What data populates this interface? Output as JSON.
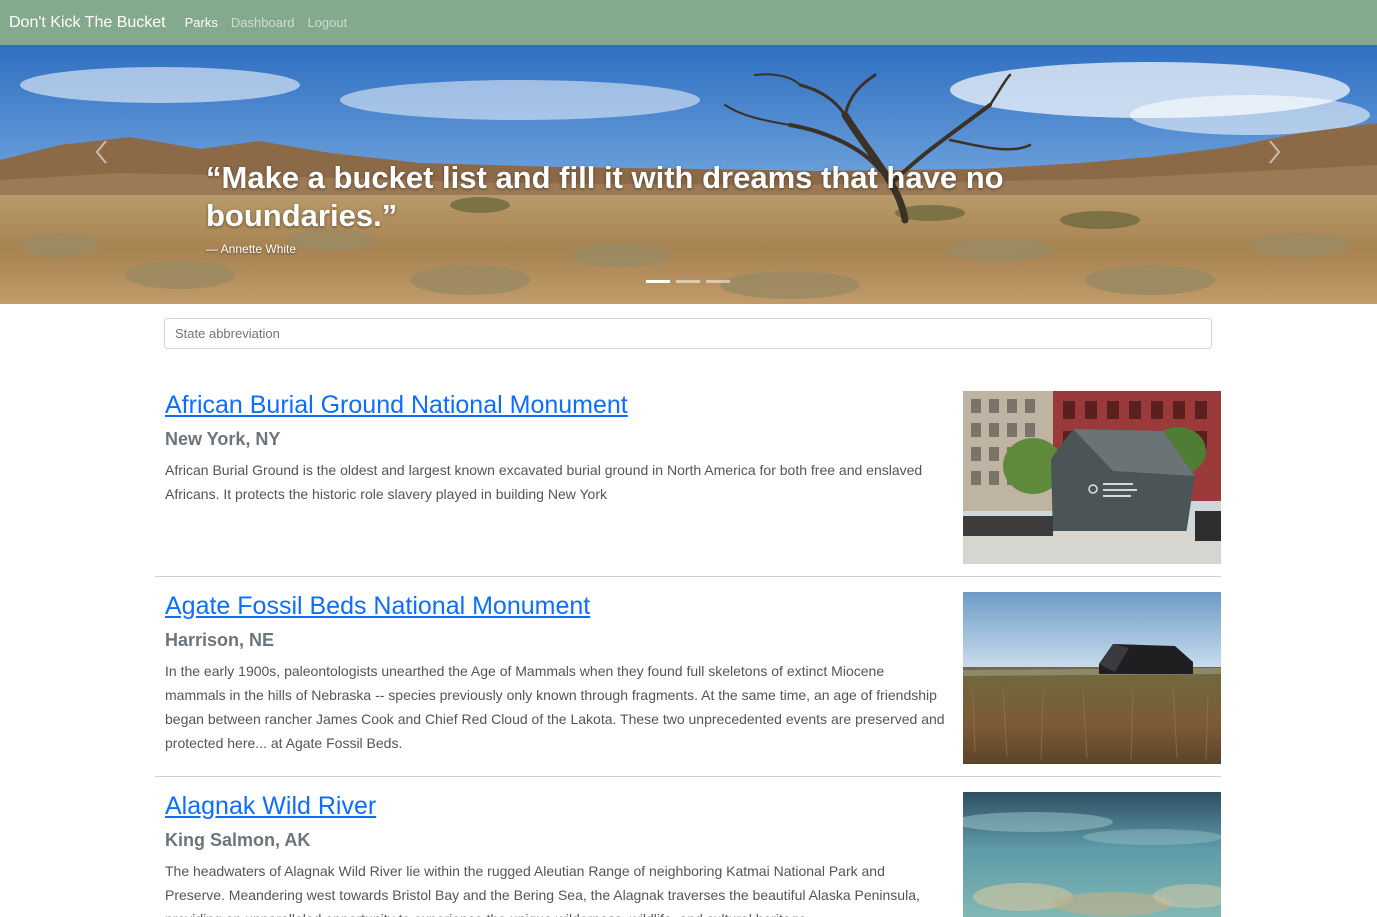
{
  "navbar": {
    "brand": "Don't Kick The Bucket",
    "links": [
      {
        "label": "Parks",
        "active": true
      },
      {
        "label": "Dashboard",
        "active": false
      },
      {
        "label": "Logout",
        "active": false
      }
    ],
    "background_color": "#84a98c"
  },
  "hero": {
    "quote": "“Make a bucket list and fill it with dreams that have no boundaries.”",
    "author": "— Annette White",
    "prev_icon": "chevron-left-icon",
    "next_icon": "chevron-right-icon",
    "slides": [
      {
        "active": true
      },
      {
        "active": false
      },
      {
        "active": false
      }
    ]
  },
  "search": {
    "placeholder": "State abbreviation",
    "value": ""
  },
  "parks": [
    {
      "name": "African Burial Ground National Monument",
      "location": "New York, NY",
      "description": "African Burial Ground is the oldest and largest known excavated burial ground in North America for both free and enslaved Africans. It protects the historic role slavery played in building New York"
    },
    {
      "name": "Agate Fossil Beds National Monument",
      "location": "Harrison, NE",
      "description": "In the early 1900s, paleontologists unearthed the Age of Mammals when they found full skeletons of extinct Miocene mammals in the hills of Nebraska -- species previously only known through fragments. At the same time, an age of friendship began between rancher James Cook and Chief Red Cloud of the Lakota. These two unprecedented events are preserved and protected here... at Agate Fossil Beds."
    },
    {
      "name": "Alagnak Wild River",
      "location": "King Salmon, AK",
      "description": "The headwaters of Alagnak Wild River lie within the rugged Aleutian Range of neighboring Katmai National Park and Preserve. Meandering west towards Bristol Bay and the Bering Sea, the Alagnak traverses the beautiful Alaska Peninsula, providing an unparalleled opportunity to experience the unique wilderness, wildlife, and cultural heritage"
    }
  ],
  "colors": {
    "link": "#0d6efd",
    "location": "#6c757d",
    "description": "#555555",
    "divider": "#cfcfcf"
  }
}
